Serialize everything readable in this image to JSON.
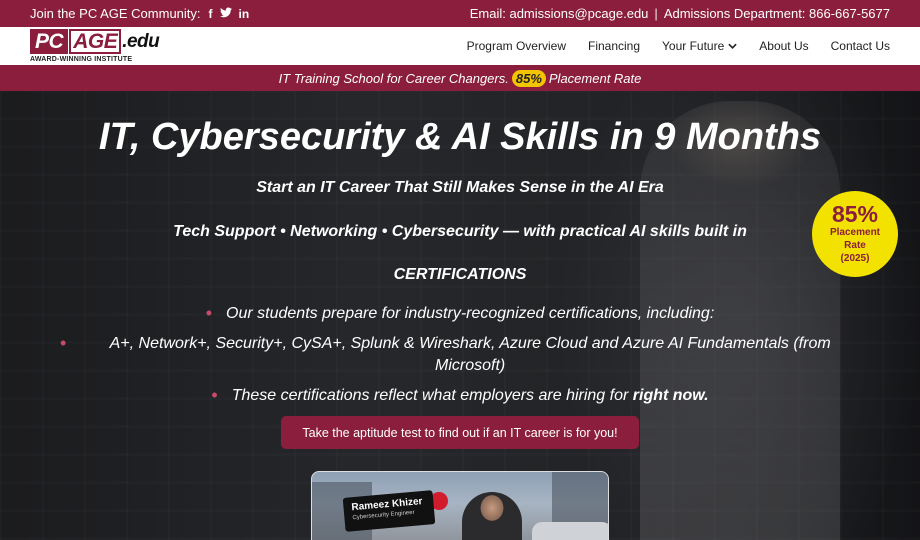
{
  "topbar": {
    "community_text": "Join the PC AGE Community:",
    "social_icons": [
      "facebook-icon",
      "twitter-icon",
      "linkedin-icon"
    ],
    "email_text": "Email: admissions@pcage.edu",
    "separator": "|",
    "phone_text": "Admissions Department: 866-667-5677",
    "bg_color": "#8a1e3c"
  },
  "nav": {
    "logo_pc": "PC",
    "logo_age": "AGE",
    "logo_edu": ".edu",
    "logo_sub": "AWARD-WINNING INSTITUTE",
    "items": [
      {
        "label": "Program Overview"
      },
      {
        "label": "Financing"
      },
      {
        "label": "Your Future"
      },
      {
        "label": "About Us"
      },
      {
        "label": "Contact Us"
      }
    ]
  },
  "banner": {
    "text_before": "IT Training School for Career Changers.",
    "highlight": "85%",
    "text_after": "Placement Rate"
  },
  "hero": {
    "title": "IT, Cybersecurity & AI Skills in 9 Months",
    "subtitle": "Start an IT Career That Still Makes Sense in the AI Era",
    "tags": "Tech Support • Networking • Cybersecurity — with practical AI skills built in",
    "cert_heading": "CERTIFICATIONS",
    "bullets": [
      "Our students prepare for industry-recognized certifications, including:",
      "A+, Network+, Security+, CySA+, Splunk & Wireshark, Azure Cloud and Azure AI Fundamentals (from Microsoft)"
    ],
    "bullet3_before": "These certifications reflect what employers are hiring for",
    "bullet3_bold": "right now.",
    "cta_label": "Take the aptitude test to find out if an IT career is for you!"
  },
  "badge": {
    "pct": "85%",
    "line1": "Placement",
    "line2": "Rate",
    "line3": "(2025)",
    "color": "#f3e200"
  },
  "video": {
    "name": "Rameez Khizer",
    "role": "Cybersecurity Engineer"
  }
}
